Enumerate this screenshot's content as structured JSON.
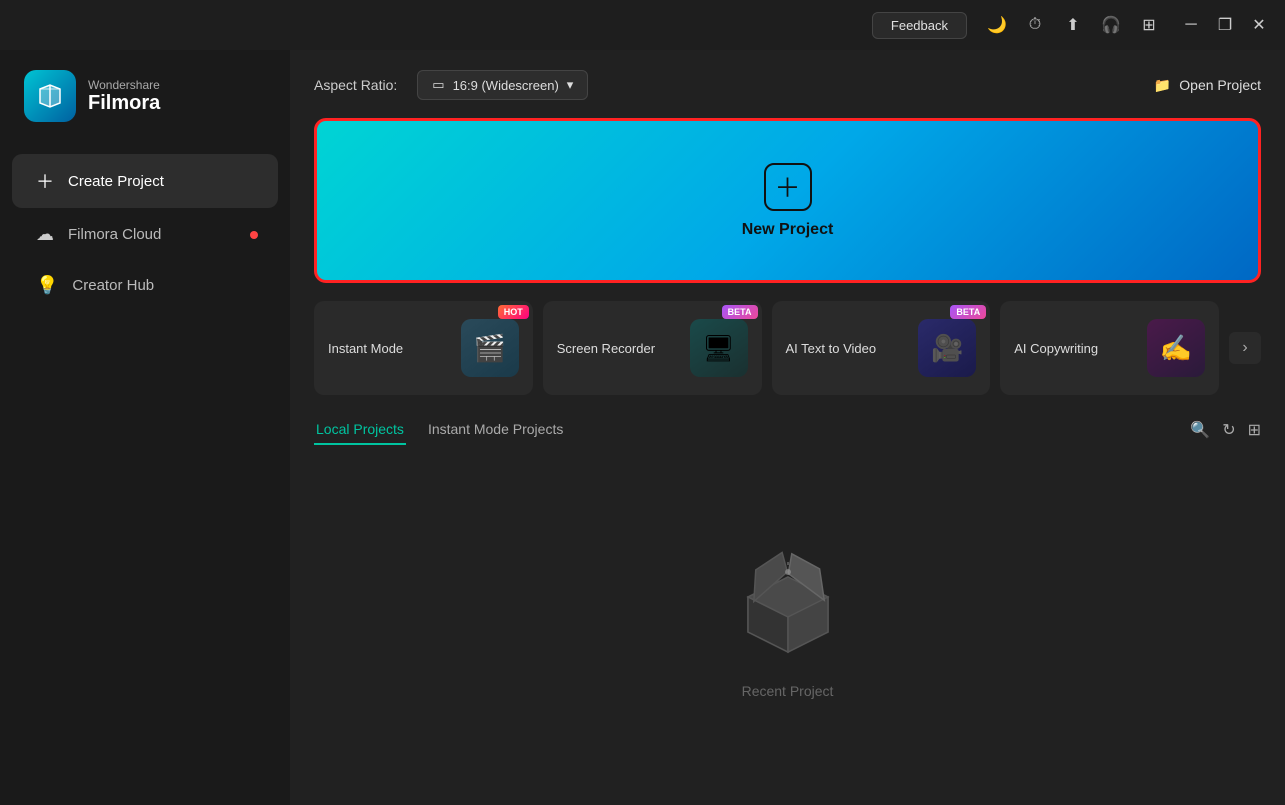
{
  "titlebar": {
    "feedback_label": "Feedback",
    "minimize_label": "─",
    "maximize_label": "❐",
    "close_label": "✕"
  },
  "logo": {
    "company": "Wondershare",
    "product": "Filmora"
  },
  "sidebar": {
    "items": [
      {
        "id": "create-project",
        "label": "Create Project",
        "icon": "＋",
        "active": true,
        "dot": false
      },
      {
        "id": "filmora-cloud",
        "label": "Filmora Cloud",
        "icon": "☁",
        "active": false,
        "dot": true
      },
      {
        "id": "creator-hub",
        "label": "Creator Hub",
        "icon": "💡",
        "active": false,
        "dot": false
      }
    ]
  },
  "aspect_ratio": {
    "label": "Aspect Ratio:",
    "value": "16:9 (Widescreen)",
    "icon": "▭"
  },
  "open_project": {
    "label": "Open Project",
    "icon": "📁"
  },
  "new_project": {
    "label": "New Project"
  },
  "feature_cards": [
    {
      "id": "instant-mode",
      "label": "Instant Mode",
      "badge": "HOT",
      "badge_type": "hot",
      "emoji": "🎬"
    },
    {
      "id": "screen-recorder",
      "label": "Screen Recorder",
      "badge": "BETA",
      "badge_type": "beta",
      "emoji": "🖥"
    },
    {
      "id": "ai-text-to-video",
      "label": "AI Text to Video",
      "badge": "BETA",
      "badge_type": "beta",
      "emoji": "🎥"
    },
    {
      "id": "ai-copywriting",
      "label": "AI Copywriting",
      "badge": "",
      "badge_type": "",
      "emoji": "✍"
    }
  ],
  "projects_tabs": {
    "tabs": [
      {
        "id": "local",
        "label": "Local Projects",
        "active": true
      },
      {
        "id": "instant",
        "label": "Instant Mode Projects",
        "active": false
      }
    ]
  },
  "empty_state": {
    "label": "Recent Project"
  }
}
